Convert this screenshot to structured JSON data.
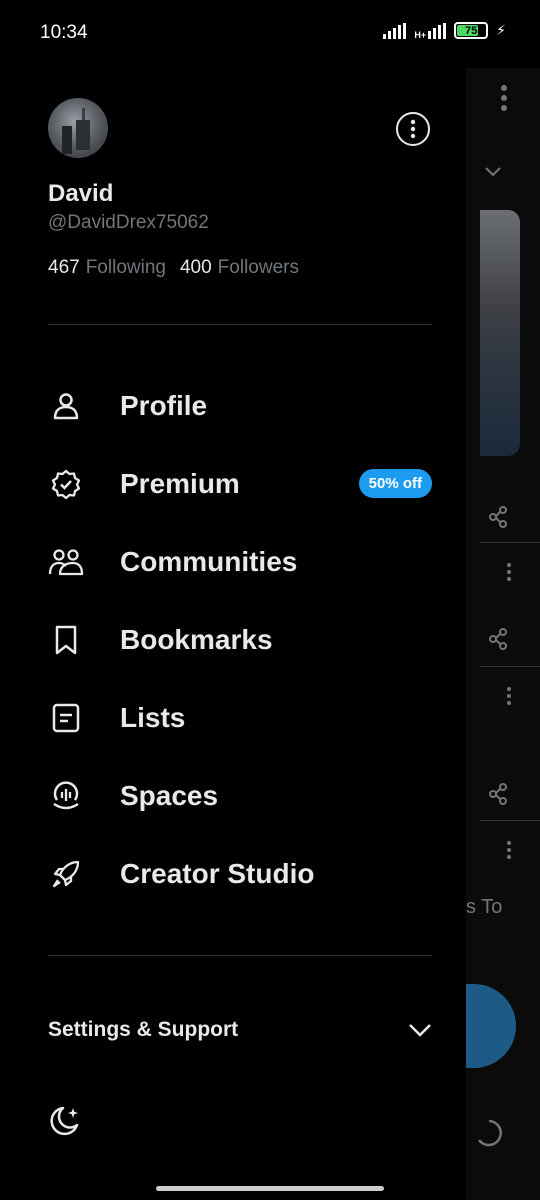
{
  "status_bar": {
    "time": "10:34",
    "network_label": "H+",
    "battery_level": "75",
    "battery_fraction": 0.75,
    "charging": true
  },
  "profile": {
    "name": "David",
    "handle": "@DavidDrex75062",
    "following_count": "467",
    "following_label": "Following",
    "followers_count": "400",
    "followers_label": "Followers"
  },
  "menu": {
    "items": [
      {
        "label": "Profile",
        "icon": "person-icon"
      },
      {
        "label": "Premium",
        "icon": "verified-badge-icon",
        "badge": "50% off"
      },
      {
        "label": "Communities",
        "icon": "communities-icon"
      },
      {
        "label": "Bookmarks",
        "icon": "bookmark-icon"
      },
      {
        "label": "Lists",
        "icon": "list-icon"
      },
      {
        "label": "Spaces",
        "icon": "spaces-icon"
      },
      {
        "label": "Creator Studio",
        "icon": "rocket-icon"
      }
    ]
  },
  "settings": {
    "label": "Settings & Support",
    "icon": "chevron-down-icon"
  },
  "background": {
    "partial_text": "s To"
  },
  "colors": {
    "accent": "#1d9bf0",
    "background": "#000000",
    "text_primary": "#e7e9ea",
    "text_secondary": "#71767b",
    "divider": "#2f3336"
  }
}
